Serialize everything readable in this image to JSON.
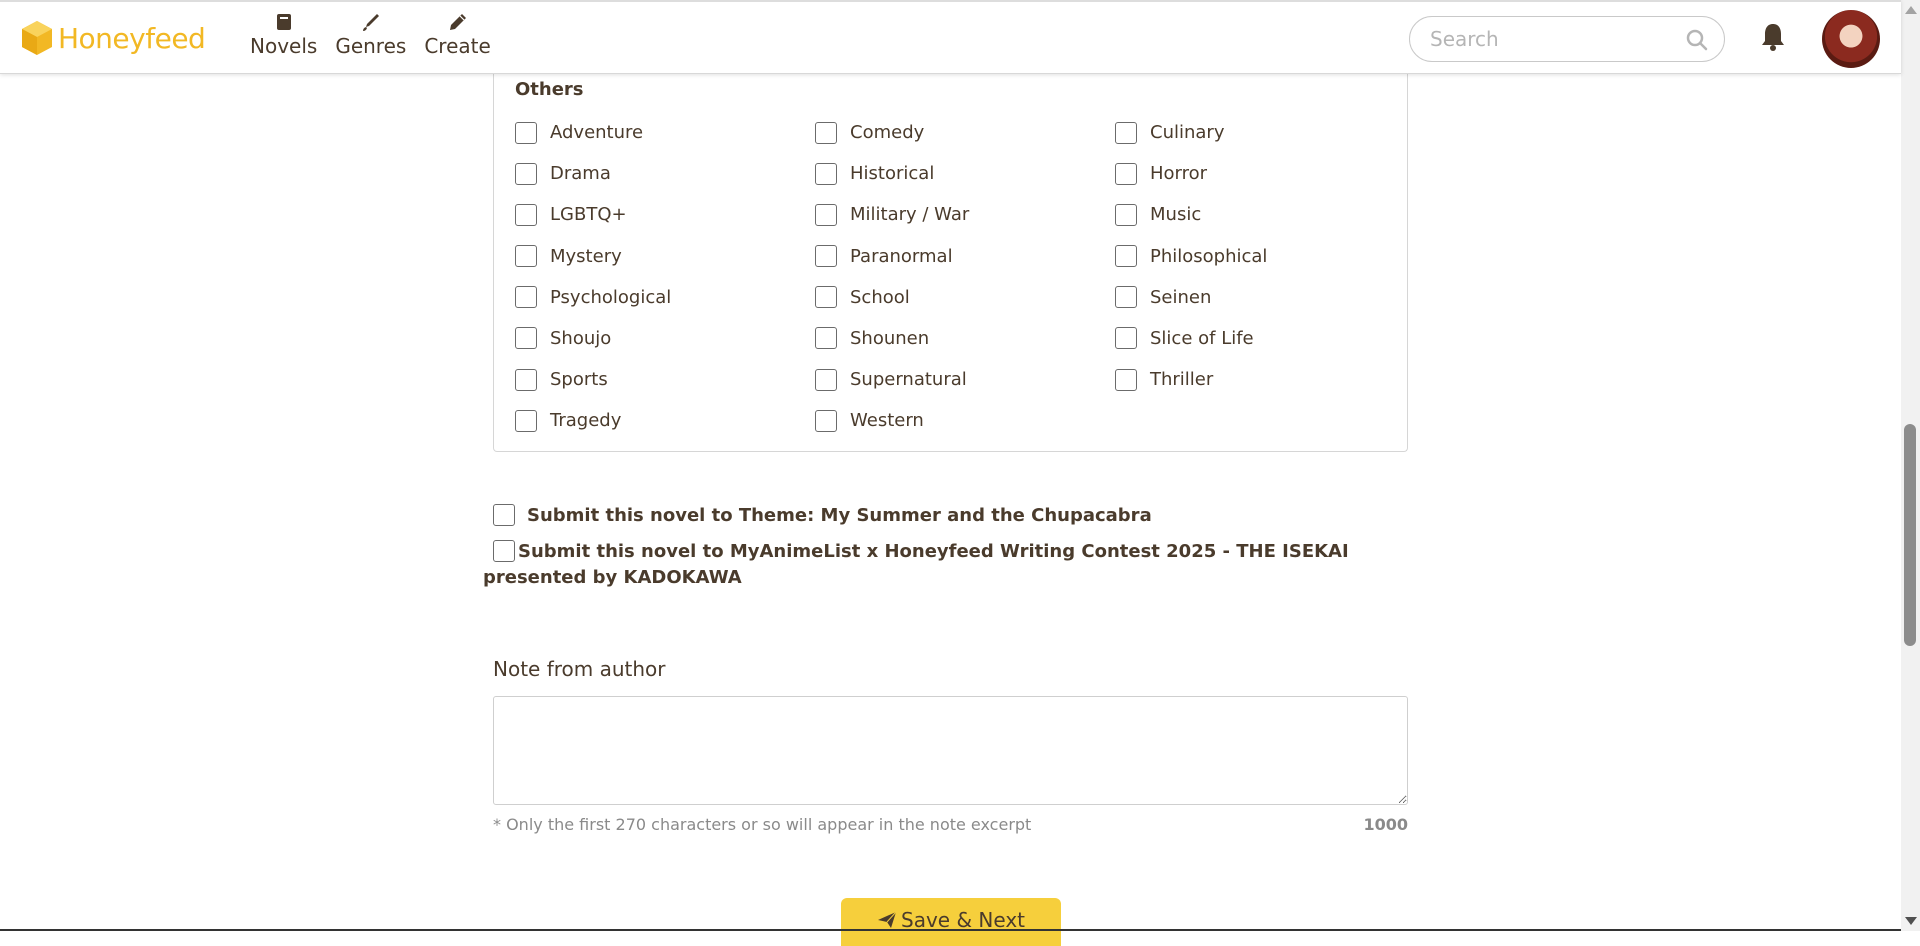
{
  "header": {
    "logo_text": "Honeyfeed",
    "nav": [
      {
        "label": "Novels",
        "icon": "book-icon"
      },
      {
        "label": "Genres",
        "icon": "brush-icon"
      },
      {
        "label": "Create",
        "icon": "pencil-icon"
      }
    ],
    "search_placeholder": "Search",
    "brand_color": "#f2b824"
  },
  "genres": {
    "group_title": "Others",
    "items": [
      "Adventure",
      "Comedy",
      "Culinary",
      "Drama",
      "Historical",
      "Horror",
      "LGBTQ+",
      "Military / War",
      "Music",
      "Mystery",
      "Paranormal",
      "Philosophical",
      "Psychological",
      "School",
      "Seinen",
      "Shoujo",
      "Shounen",
      "Slice of Life",
      "Sports",
      "Supernatural",
      "Thriller",
      "Tragedy",
      "Western"
    ]
  },
  "submit_options": {
    "theme": "Submit this novel to Theme: My Summer and the Chupacabra",
    "contest": "Submit this novel to MyAnimeList x Honeyfeed Writing Contest 2025 - THE ISEKAI presented by KADOKAWA"
  },
  "note": {
    "title": "Note from author",
    "value": "",
    "hint": "* Only the first 270 characters or so will appear in the note excerpt",
    "char_count": "1000"
  },
  "save_button": {
    "label": "Save & Next",
    "color": "#f6cf3c"
  }
}
